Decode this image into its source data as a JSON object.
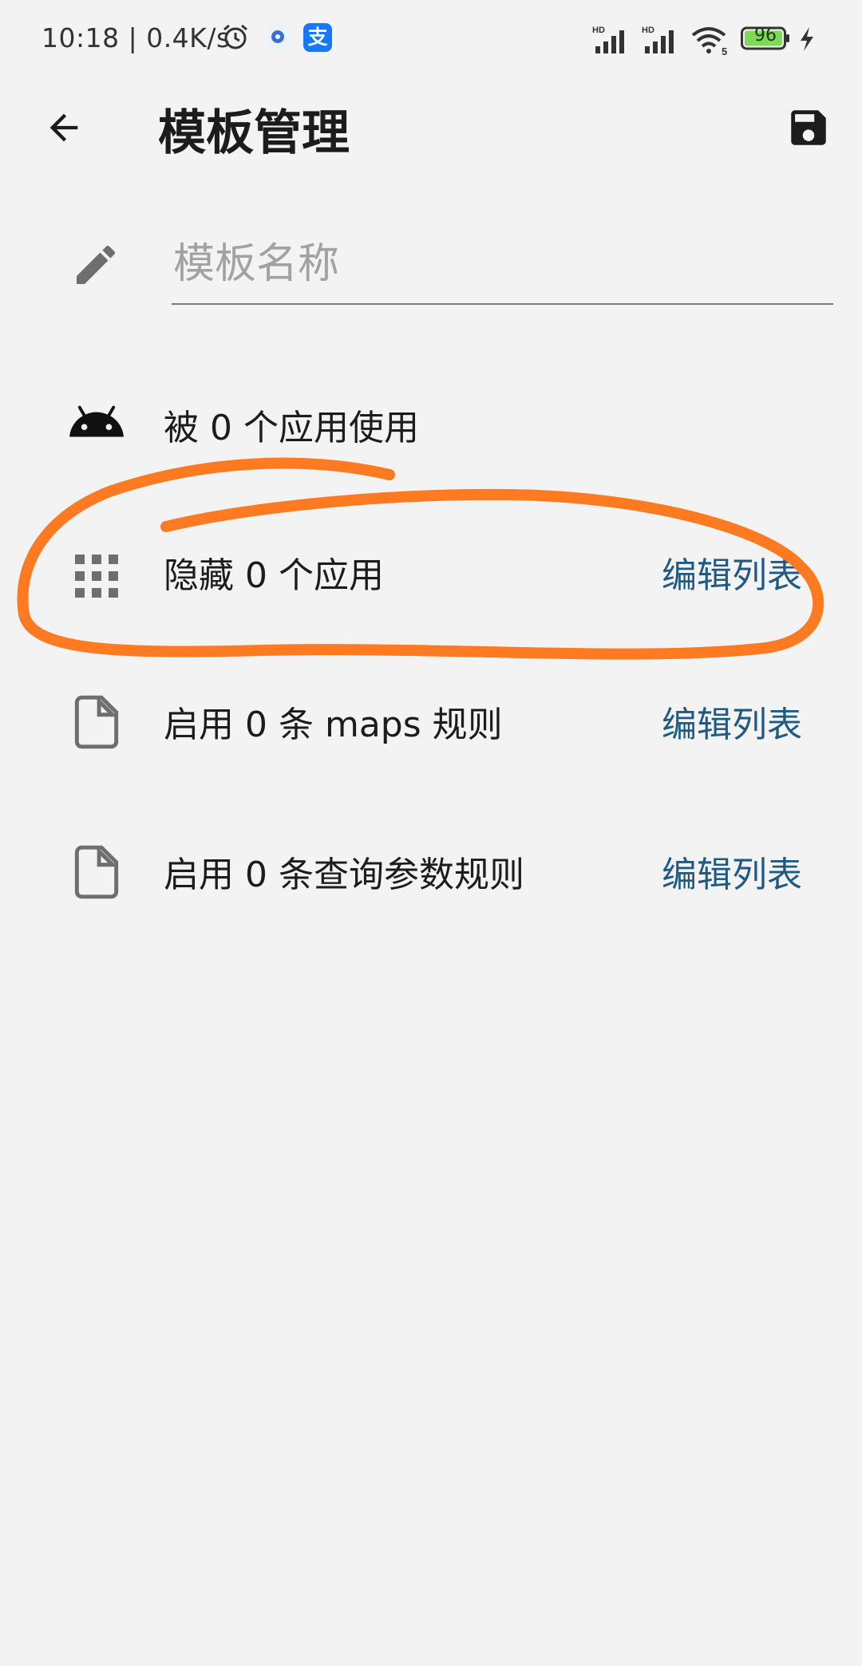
{
  "status_bar": {
    "time": "10:18 | 0.4K/s",
    "battery": "96",
    "app_icon_label": "支"
  },
  "toolbar": {
    "title": "模板管理",
    "back_icon": "arrow-back-icon",
    "save_icon": "save-icon"
  },
  "name_field": {
    "placeholder": "模板名称",
    "value": ""
  },
  "items": [
    {
      "text": "被 0 个应用使用",
      "icon": "android-icon",
      "action": ""
    },
    {
      "text": "隐藏 0 个应用",
      "icon": "grid-icon",
      "action": "编辑列表"
    },
    {
      "text": "启用 0 条 maps 规则",
      "icon": "file-icon",
      "action": "编辑列表"
    },
    {
      "text": "启用 0 条查询参数规则",
      "icon": "file-icon",
      "action": "编辑列表"
    }
  ],
  "colors": {
    "background": "#f3f3f3",
    "accent_link": "#1f5a85",
    "annotation": "#ff7a20",
    "icon": "#6e6e6e"
  }
}
